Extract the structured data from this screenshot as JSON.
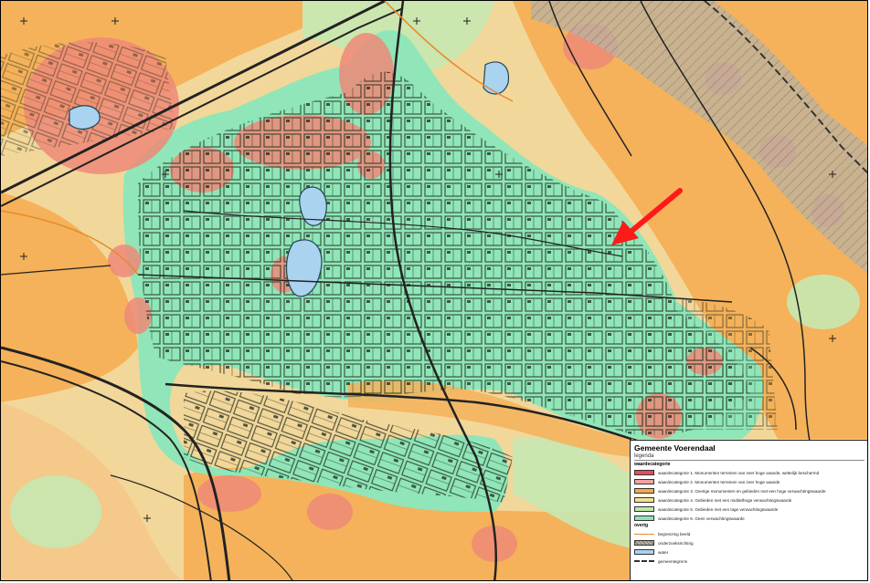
{
  "legend": {
    "title": "Gemeente Voerendaal",
    "subtitle": "legenda",
    "section_values": "waardecategorie",
    "items": [
      {
        "label": "waardecategorie 1. Monumenten terreinen van zeer hoge waarde, wettelijk beschermd",
        "color": "#e84b5a"
      },
      {
        "label": "waardecategorie 2. Monumenten terreinen van zeer hoge waarde",
        "color": "#f4a3a0"
      },
      {
        "label": "waardecategorie 3. Overige monumenten en gebieden met een hoge verwachtingswaarde",
        "color": "#f5a94a"
      },
      {
        "label": "waardecategorie 4. Gebieden met een middelhoge verwachtingswaarde",
        "color": "#f6e08a"
      },
      {
        "label": "waardecategorie 5. Gebieden met een lage verwachtingswaarde",
        "color": "#bfe8a8"
      },
      {
        "label": "waardecategorie 6. Geen verwachtingswaarde",
        "color": "#8fe3b7"
      }
    ],
    "section_other": "overig",
    "other_items": [
      {
        "label": "begrenzing beeld",
        "kind": "line-orange"
      },
      {
        "label": "onderzoeksrichting",
        "kind": "hatch"
      },
      {
        "label": "water",
        "kind": "water"
      },
      {
        "label": "gemeentegrens",
        "kind": "line-dash"
      }
    ]
  },
  "colors": {
    "orange_zone": "#f5b25a",
    "yellow_zone": "#f2d79a",
    "green_zone": "#90e6b8",
    "red_zone": "#ef8a78",
    "water": "#aad3ef",
    "arrow": "#ff1a1a"
  },
  "icons": {
    "arrow": "red-arrow-icon",
    "crosshair": "plus-marker-icon"
  }
}
